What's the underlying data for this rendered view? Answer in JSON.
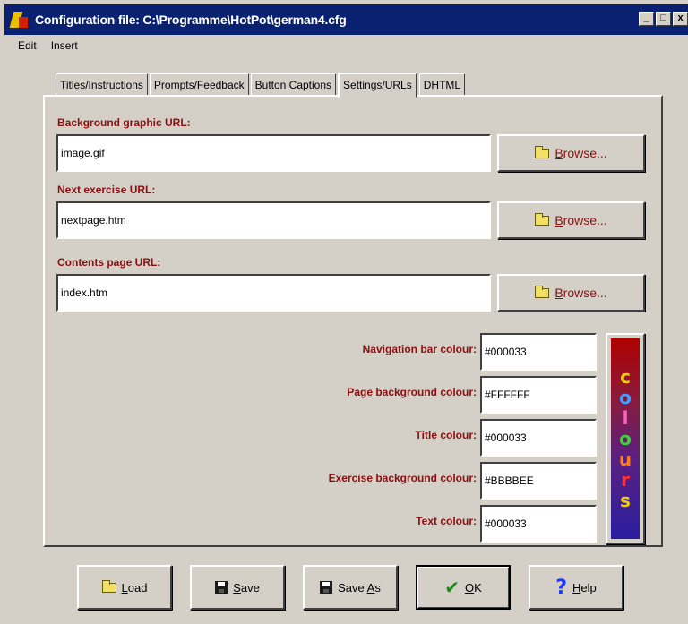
{
  "window": {
    "title": "Configuration file: C:\\Programme\\HotPot\\german4.cfg",
    "controls": [
      "_",
      "□",
      "x"
    ]
  },
  "menu": [
    {
      "label": "Edit"
    },
    {
      "label": "Insert"
    }
  ],
  "tabs": [
    {
      "label": "Titles/Instructions",
      "active": false
    },
    {
      "label": "Prompts/Feedback",
      "active": false
    },
    {
      "label": "Button Captions",
      "active": false
    },
    {
      "label": "Settings/URLs",
      "active": true
    },
    {
      "label": "DHTML",
      "active": false
    }
  ],
  "fields": {
    "background_graphic": {
      "label": "Background graphic URL:",
      "value": "image.gif"
    },
    "next_exercise": {
      "label": "Next exercise URL:",
      "value": "nextpage.htm"
    },
    "contents_page": {
      "label": "Contents page URL:",
      "value": "index.htm"
    }
  },
  "browse_button": {
    "first_letter": "B",
    "rest": "rowse..."
  },
  "colours": [
    {
      "label": "Navigation bar colour:",
      "value": "#000033"
    },
    {
      "label": "Page background colour:",
      "value": "#FFFFFF"
    },
    {
      "label": "Title colour:",
      "value": "#000033"
    },
    {
      "label": "Exercise background colour:",
      "value": "#BBBBEE"
    },
    {
      "label": "Text colour:",
      "value": "#000033"
    }
  ],
  "colours_button": {
    "letters": [
      {
        "char": "c",
        "color": "#f0d000"
      },
      {
        "char": "o",
        "color": "#40a0ff"
      },
      {
        "char": "l",
        "color": "#ff60c0"
      },
      {
        "char": "o",
        "color": "#40d040"
      },
      {
        "char": "u",
        "color": "#ff8020"
      },
      {
        "char": "r",
        "color": "#ff3030"
      },
      {
        "char": "s",
        "color": "#f0d000"
      }
    ]
  },
  "buttons": {
    "load": {
      "u": "L",
      "rest": "oad"
    },
    "save": {
      "u": "S",
      "rest": "ave"
    },
    "save_as": {
      "pre": "Save ",
      "u": "A",
      "rest": "s"
    },
    "ok": {
      "u": "O",
      "rest": "K"
    },
    "help": {
      "u": "H",
      "rest": "elp"
    }
  },
  "colors": {
    "title_bar": "#0a2070",
    "label_text": "#8b1010",
    "face": "#d4d0c8"
  }
}
